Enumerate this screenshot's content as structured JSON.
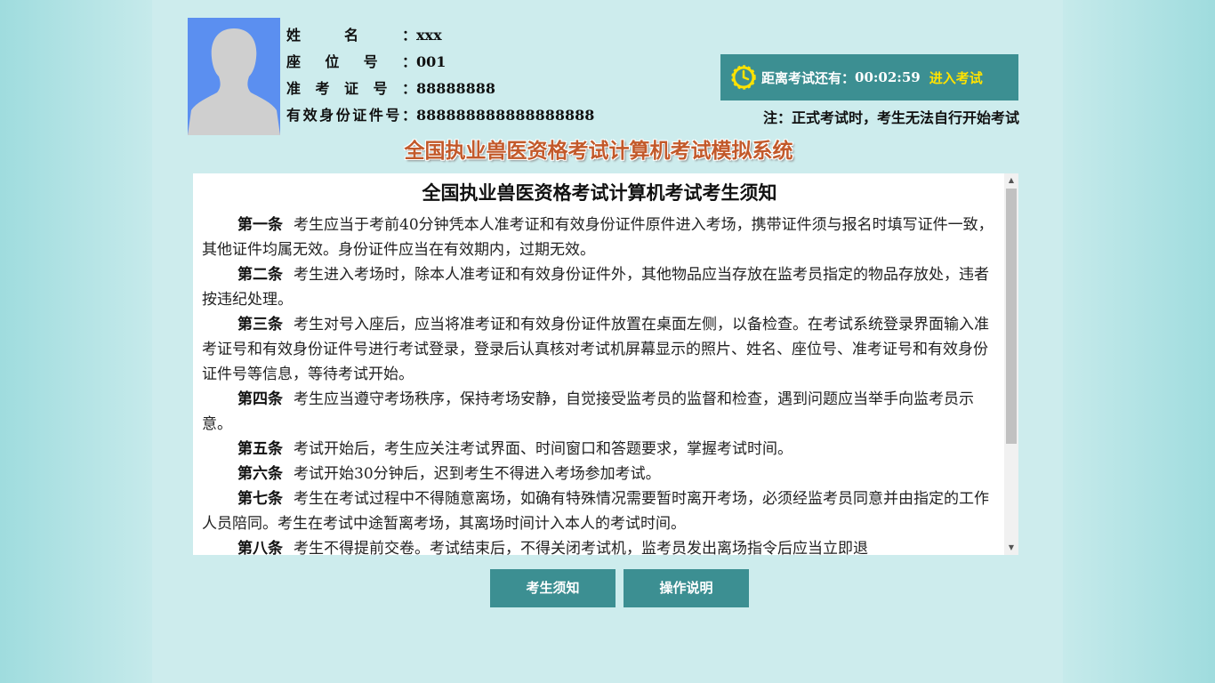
{
  "candidate": {
    "name_label": "姓名：",
    "name_value": "xxx",
    "seat_label": "座位号：",
    "seat_value": "001",
    "ticket_label": "准考证号：",
    "ticket_value": "88888888",
    "id_label": "有效身份证件号：",
    "id_value": "888888888888888888"
  },
  "timer": {
    "label": "距离考试还有：",
    "time": "00:02:59",
    "enter_label": "进入考试"
  },
  "note": "注：正式考试时，考生无法自行开始考试",
  "system_title": "全国执业兽医资格考试计算机考试模拟系统",
  "notice": {
    "title": "全国执业兽医资格考试计算机考试考生须知",
    "articles": [
      {
        "head": "第一条",
        "text": "考生应当于考前40分钟凭本人准考证和有效身份证件原件进入考场，携带证件须与报名时填写证件一致，其他证件均属无效。身份证件应当在有效期内，过期无效。"
      },
      {
        "head": "第二条",
        "text": "考生进入考场时，除本人准考证和有效身份证件外，其他物品应当存放在监考员指定的物品存放处，违者按违纪处理。"
      },
      {
        "head": "第三条",
        "text": "考生对号入座后，应当将准考证和有效身份证件放置在桌面左侧，以备检查。在考试系统登录界面输入准考证号和有效身份证件号进行考试登录，登录后认真核对考试机屏幕显示的照片、姓名、座位号、准考证号和有效身份证件号等信息，等待考试开始。"
      },
      {
        "head": "第四条",
        "text": "考生应当遵守考场秩序，保持考场安静，自觉接受监考员的监督和检查，遇到问题应当举手向监考员示意。"
      },
      {
        "head": "第五条",
        "text": "考试开始后，考生应关注考试界面、时间窗口和答题要求，掌握考试时间。"
      },
      {
        "head": "第六条",
        "text": "考试开始30分钟后，迟到考生不得进入考场参加考试。"
      },
      {
        "head": "第七条",
        "text": "考生在考试过程中不得随意离场，如确有特殊情况需要暂时离开考场，必须经监考员同意并由指定的工作人员陪同。考生在考试中途暂离考场，其离场时间计入本人的考试时间。"
      },
      {
        "head": "第八条",
        "text": "考生不得提前交卷。考试结束后，不得关闭考试机，监考员发出离场指令后应当立即退"
      }
    ]
  },
  "buttons": {
    "notice": "考生须知",
    "instructions": "操作说明"
  }
}
